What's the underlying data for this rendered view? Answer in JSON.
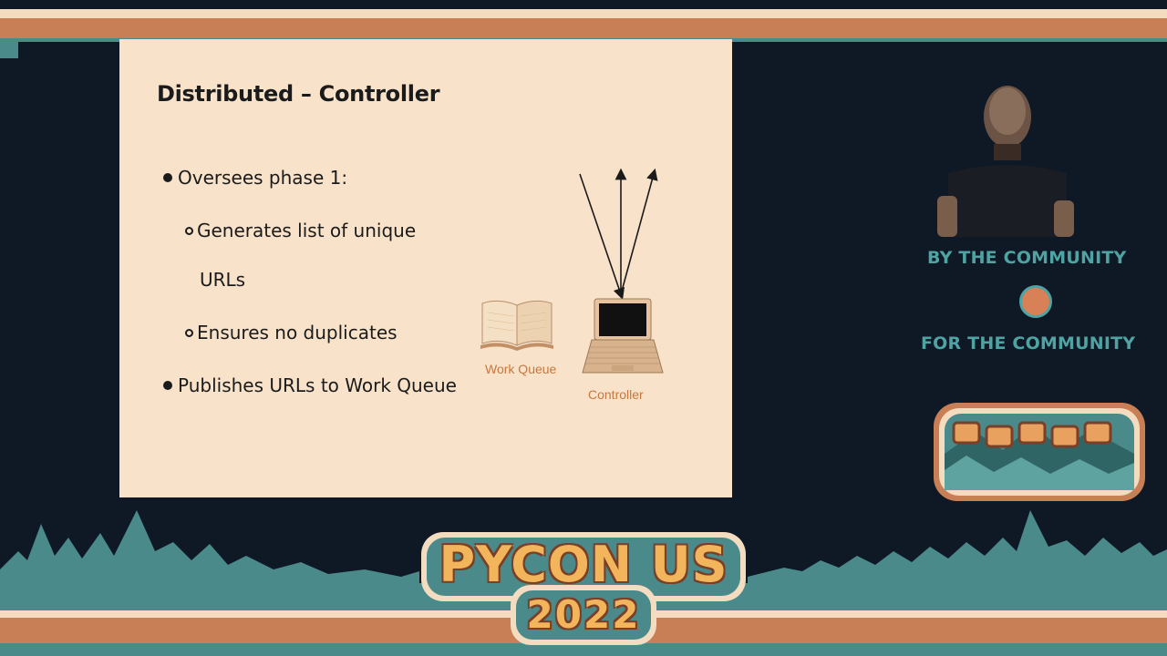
{
  "slide": {
    "title": "Distributed – Controller",
    "bullets": {
      "b1": "Oversees phase 1:",
      "b1_sub1_line1": "Generates list of unique",
      "b1_sub1_line2": "URLs",
      "b1_sub2": "Ensures no duplicates",
      "b2": "Publishes URLs to Work Queue"
    },
    "diagram": {
      "work_queue_label": "Work Queue",
      "controller_label": "Controller"
    }
  },
  "sidebar": {
    "by_community": "BY THE COMMUNITY",
    "for_community": "FOR THE COMMUNITY"
  },
  "event": {
    "name": "PYCON US",
    "year": "2022"
  },
  "colors": {
    "slide_bg": "#f8e2c9",
    "background": "#0f1825",
    "accent_orange": "#c97f56",
    "accent_teal": "#4a8a8a",
    "label_orange": "#c7783f"
  }
}
